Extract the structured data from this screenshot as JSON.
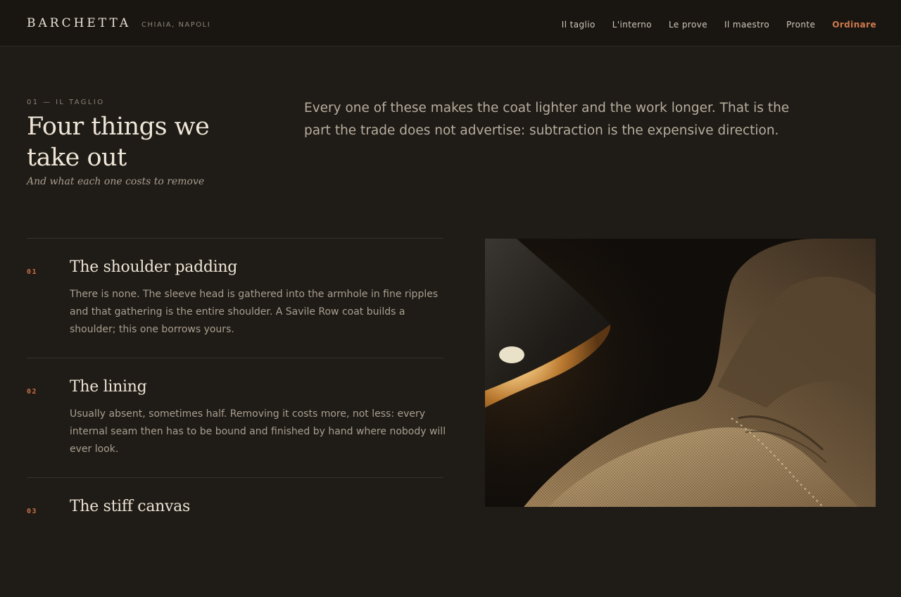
{
  "header": {
    "brand": "BARCHETTA",
    "location": "CHIAIA, NAPOLI",
    "nav": [
      {
        "label": "Il taglio"
      },
      {
        "label": "L'interno"
      },
      {
        "label": "Le prove"
      },
      {
        "label": "Il maestro"
      },
      {
        "label": "Pronte"
      },
      {
        "label": "Ordinare"
      }
    ],
    "accent_color": "#d07a4c"
  },
  "intro": {
    "eyebrow": "01 — IL TAGLIO",
    "title": "Four things we take out",
    "subtitle": "And what each one costs to remove",
    "lede": "Every one of these makes the coat lighter and the work longer. That is the part the trade does not advertise: subtraction is the expensive direction."
  },
  "items": [
    {
      "number": "01",
      "title": "The shoulder padding",
      "body": "There is none. The sleeve head is gathered into the armhole in fine ripples and that gathering is the entire shoulder. A Savile Row coat builds a shoulder; this one borrows yours."
    },
    {
      "number": "02",
      "title": "The lining",
      "body": "Usually absent, sometimes half. Removing it costs more, not less: every internal seam then has to be bound and finished by hand where nobody will ever look."
    },
    {
      "number": "03",
      "title": "The stiff canvas",
      "body": ""
    }
  ],
  "image": {
    "subject": "lamp lighting a linen jacket shoulder seam"
  }
}
